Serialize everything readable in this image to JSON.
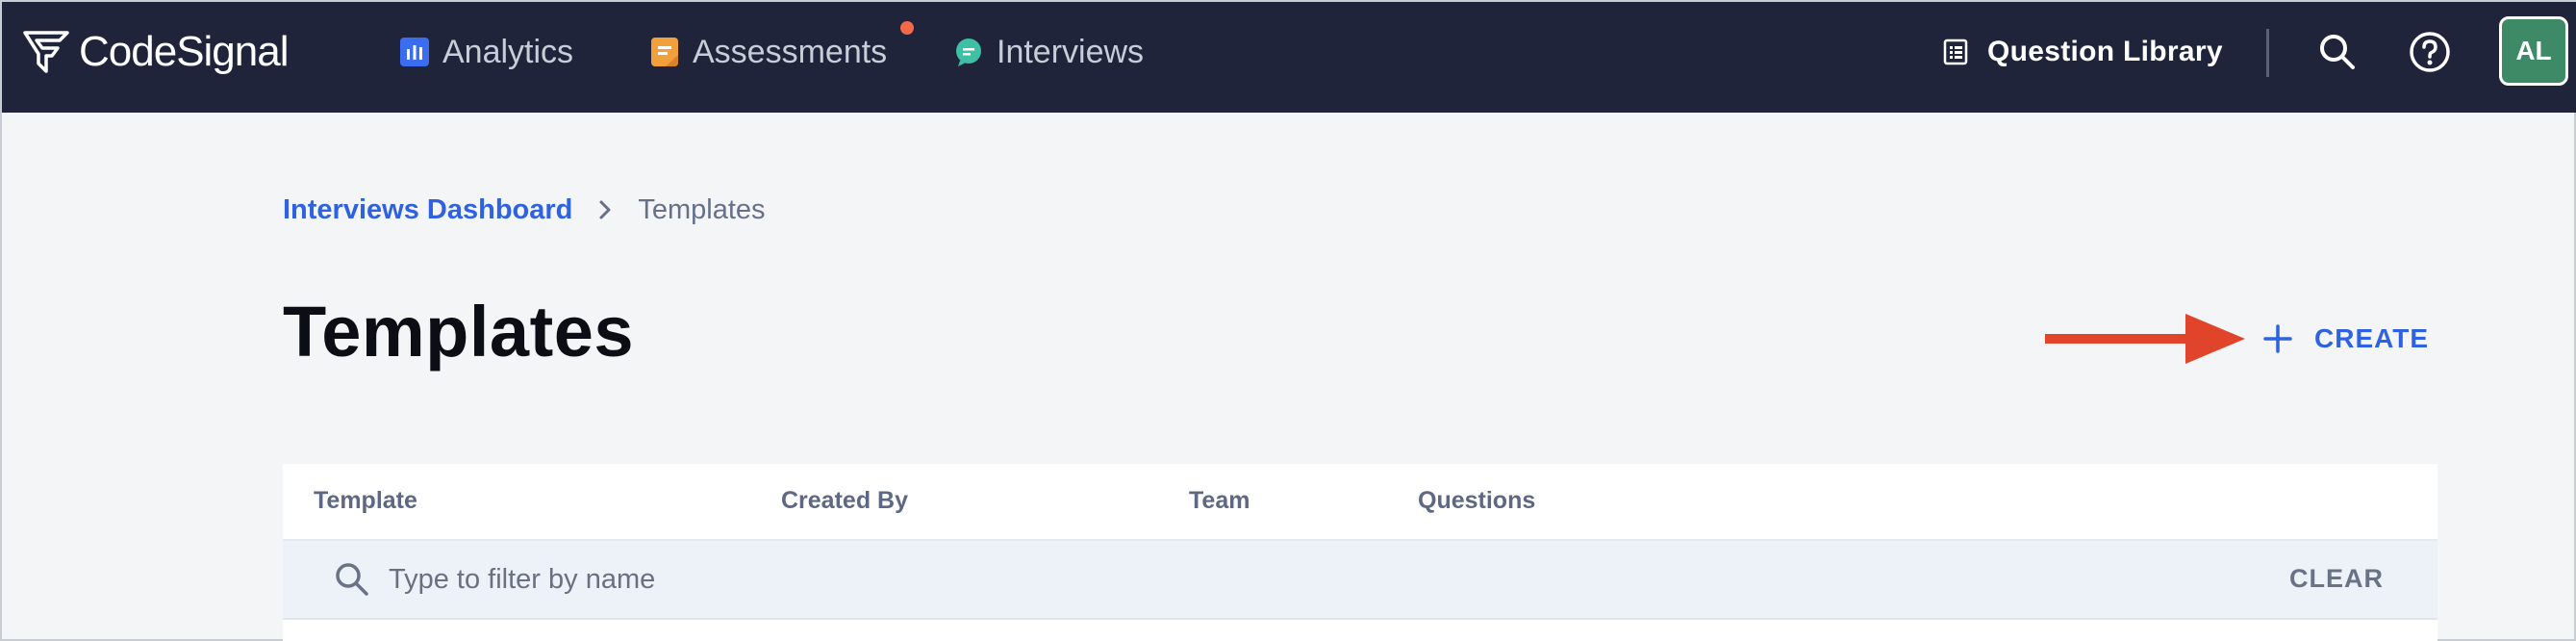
{
  "app": {
    "logo_text": "CodeSignal",
    "nav": [
      {
        "label": "Analytics",
        "icon": "bar-chart-icon",
        "color": "#3b6df0"
      },
      {
        "label": "Assessments",
        "icon": "clipboard-icon",
        "color": "#f2a03c"
      },
      {
        "label": "Interviews",
        "icon": "chat-bubble-icon",
        "color": "#3fbfa3"
      }
    ],
    "question_library": "Question Library",
    "avatar_initials": "AL",
    "accent": "#2f62e0",
    "notification_color": "#f2694b"
  },
  "breadcrumb": {
    "parent": "Interviews Dashboard",
    "current": "Templates"
  },
  "page": {
    "title": "Templates",
    "create_label": "CREATE"
  },
  "table": {
    "columns": [
      "Template",
      "Created By",
      "Team",
      "Questions"
    ],
    "filter_placeholder": "Type to filter by name",
    "clear_label": "CLEAR"
  }
}
